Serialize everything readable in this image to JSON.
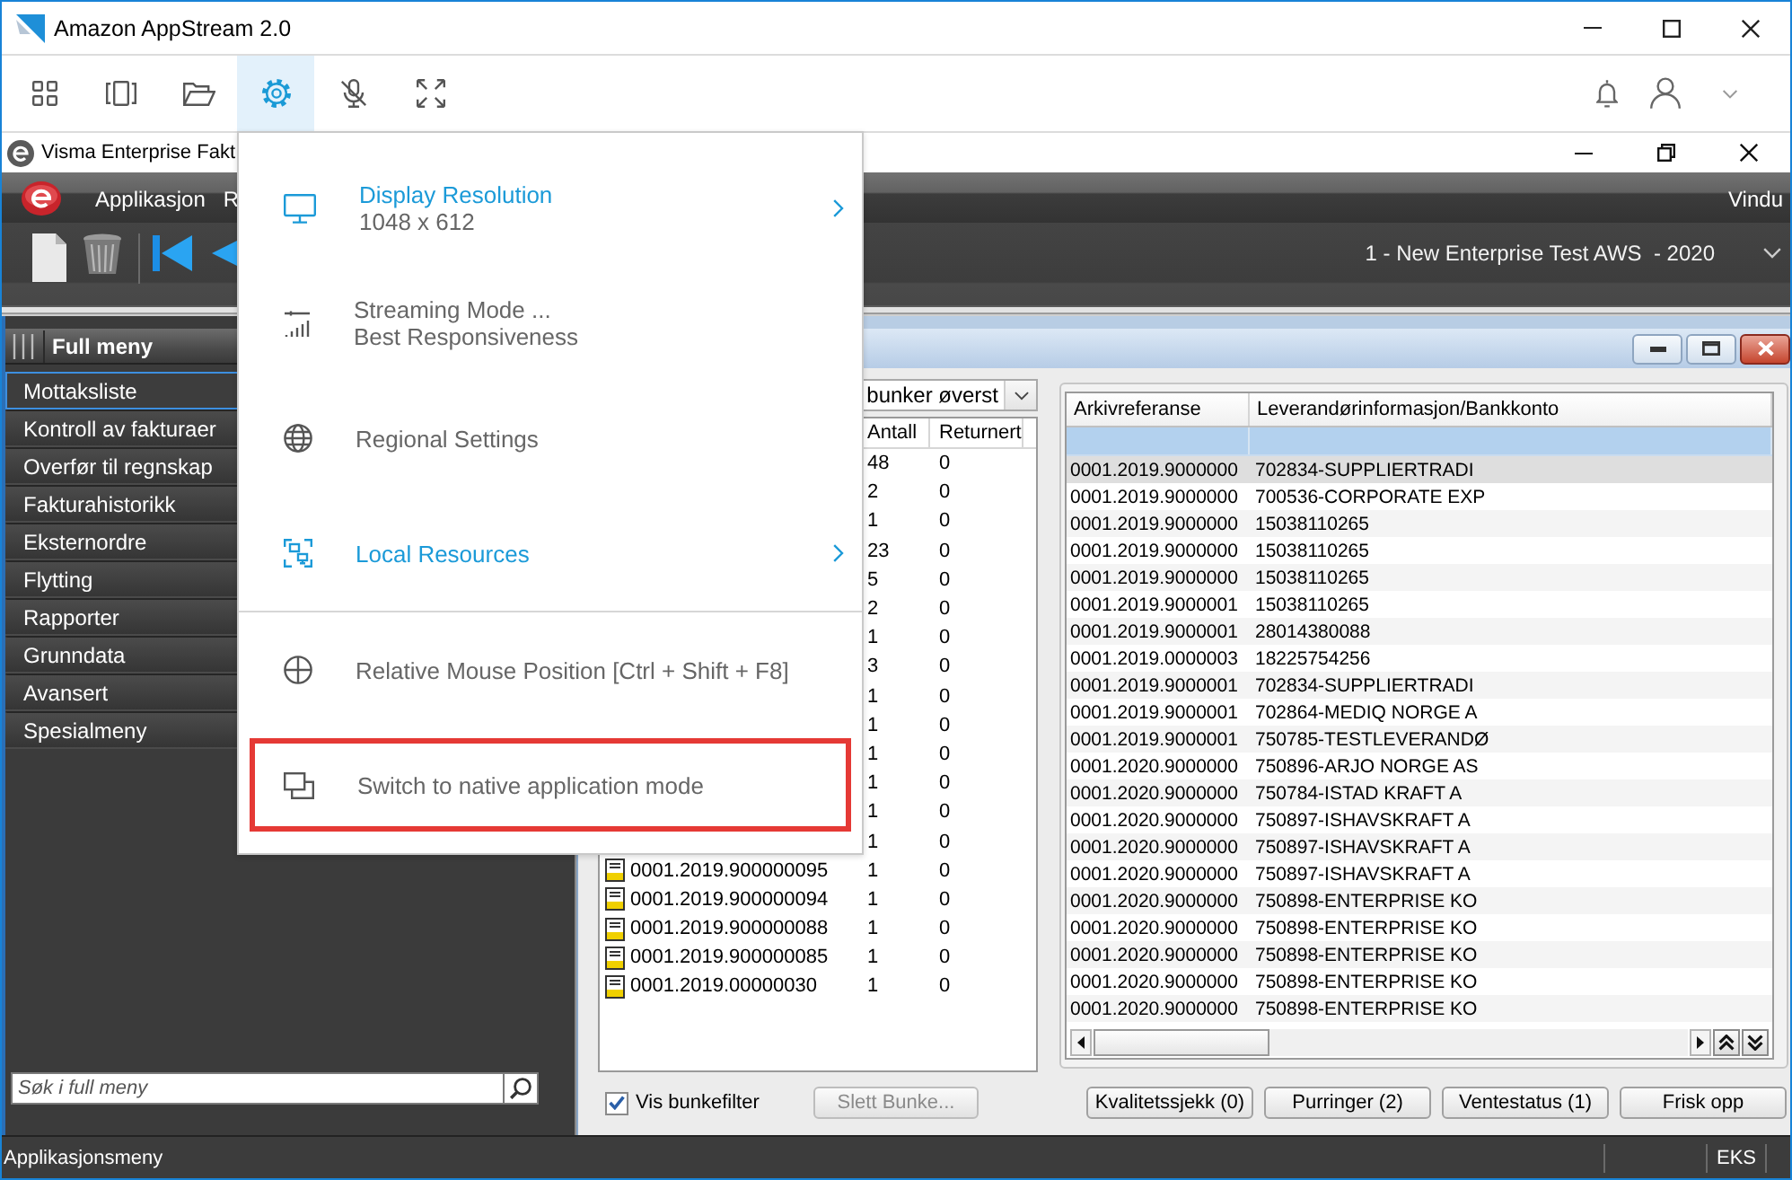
{
  "window": {
    "title": "Amazon AppStream 2.0"
  },
  "toolbar": {
    "buttons": [
      {
        "selected": false
      },
      {
        "selected": false
      },
      {
        "selected": false
      },
      {
        "selected": true
      },
      {
        "selected": false
      },
      {
        "selected": false
      }
    ]
  },
  "settings_menu": {
    "groups": [
      [
        {
          "kind": "submenu",
          "label": "Display Resolution",
          "detail": "1048 x 612",
          "outlined": false
        },
        {
          "kind": "action",
          "label": "Streaming Mode ...",
          "detail": "Best Responsiveness",
          "outlined": false
        },
        {
          "kind": "action",
          "label": "Regional Settings",
          "outlined": false
        },
        {
          "kind": "submenu",
          "label": "Local Resources",
          "outlined": false
        }
      ],
      [
        {
          "kind": "action",
          "label": "Relative Mouse Position [Ctrl + Shift + F8]",
          "outlined": false
        },
        {
          "kind": "action",
          "label": "Switch to native application mode",
          "outlined": true
        }
      ]
    ]
  },
  "app_window": {
    "title": "Visma Enterprise Fakt",
    "menu": [
      "Applikasjon",
      "R"
    ],
    "window_menu": "Vindu",
    "company": "1 - New Enterprise Test AWS  - 2020"
  },
  "sidebar": {
    "title": "Full meny",
    "items": [
      {
        "label": "Mottaksliste",
        "selected": true
      },
      {
        "label": "Kontroll av fakturaer",
        "selected": false
      },
      {
        "label": "Overfør til regnskap",
        "selected": false
      },
      {
        "label": "Fakturahistorikk",
        "selected": false
      },
      {
        "label": "Eksternordre",
        "selected": false
      },
      {
        "label": "Flytting",
        "selected": false
      },
      {
        "label": "Rapporter",
        "selected": false
      },
      {
        "label": "Grunndata",
        "selected": false
      },
      {
        "label": "Avansert",
        "selected": false
      },
      {
        "label": "Spesialmeny",
        "selected": false
      }
    ],
    "search": {
      "placeholder": "Søk i full meny"
    }
  },
  "batch_panel": {
    "sort": "bunker øverst",
    "columns": [
      "Antall",
      "Returnert"
    ],
    "rows": [
      {
        "count": "48",
        "returned": "0"
      },
      {
        "count": "2",
        "returned": "0"
      },
      {
        "count": "1",
        "returned": "0"
      },
      {
        "count": "23",
        "returned": "0"
      },
      {
        "count": "5",
        "returned": "0"
      },
      {
        "count": "2",
        "returned": "0"
      },
      {
        "count": "1",
        "returned": "0"
      },
      {
        "count": "3",
        "returned": "0"
      },
      {
        "count": "1",
        "returned": "0"
      },
      {
        "count": "1",
        "returned": "0"
      },
      {
        "count": "1",
        "returned": "0"
      },
      {
        "count": "1",
        "returned": "0"
      },
      {
        "count": "1",
        "returned": "0"
      },
      {
        "count": "1",
        "returned": "0"
      },
      {
        "name": "0001.2019.900000095",
        "count": "1",
        "returned": "0"
      },
      {
        "name": "0001.2019.900000094",
        "count": "1",
        "returned": "0"
      },
      {
        "name": "0001.2019.900000088",
        "count": "1",
        "returned": "0"
      },
      {
        "name": "0001.2019.900000085",
        "count": "1",
        "returned": "0"
      },
      {
        "name": "0001.2019.00000030",
        "count": "1",
        "returned": "0"
      }
    ],
    "filter": {
      "label": "Vis bunkefilter",
      "checked": true
    },
    "delete_button": {
      "label": "Slett Bunke...",
      "disabled": true
    }
  },
  "invoice_table": {
    "columns": [
      "Arkivreferanse",
      "Leverandørinformasjon/Bankkonto"
    ],
    "rows": [
      {
        "reference": "0001.2019.9000000",
        "supplier": "702834-SUPPLIERTRADI",
        "selected": true
      },
      {
        "reference": "0001.2019.9000000",
        "supplier": "700536-CORPORATE EXP",
        "selected": false
      },
      {
        "reference": "0001.2019.9000000",
        "supplier": "15038110265",
        "selected": false
      },
      {
        "reference": "0001.2019.9000000",
        "supplier": "15038110265",
        "selected": false
      },
      {
        "reference": "0001.2019.9000000",
        "supplier": "15038110265",
        "selected": false
      },
      {
        "reference": "0001.2019.9000001",
        "supplier": "15038110265",
        "selected": false
      },
      {
        "reference": "0001.2019.9000001",
        "supplier": "28014380088",
        "selected": false
      },
      {
        "reference": "0001.2019.0000003",
        "supplier": "18225754256",
        "selected": false
      },
      {
        "reference": "0001.2019.9000001",
        "supplier": "702834-SUPPLIERTRADI",
        "selected": false
      },
      {
        "reference": "0001.2019.9000001",
        "supplier": "702864-MEDIQ NORGE A",
        "selected": false
      },
      {
        "reference": "0001.2019.9000001",
        "supplier": "750785-TESTLEVERANDØ",
        "selected": false
      },
      {
        "reference": "0001.2020.9000000",
        "supplier": "750896-ARJO NORGE AS",
        "selected": false
      },
      {
        "reference": "0001.2020.9000000",
        "supplier": "750784-ISTAD KRAFT A",
        "selected": false
      },
      {
        "reference": "0001.2020.9000000",
        "supplier": "750897-ISHAVSKRAFT A",
        "selected": false
      },
      {
        "reference": "0001.2020.9000000",
        "supplier": "750897-ISHAVSKRAFT A",
        "selected": false
      },
      {
        "reference": "0001.2020.9000000",
        "supplier": "750897-ISHAVSKRAFT A",
        "selected": false
      },
      {
        "reference": "0001.2020.9000000",
        "supplier": "750898-ENTERPRISE KO",
        "selected": false
      },
      {
        "reference": "0001.2020.9000000",
        "supplier": "750898-ENTERPRISE KO",
        "selected": false
      },
      {
        "reference": "0001.2020.9000000",
        "supplier": "750898-ENTERPRISE KO",
        "selected": false
      },
      {
        "reference": "0001.2020.9000000",
        "supplier": "750898-ENTERPRISE KO",
        "selected": false
      },
      {
        "reference": "0001.2020.9000000",
        "supplier": "750898-ENTERPRISE KO",
        "selected": false
      }
    ]
  },
  "action_buttons": [
    "Kvalitetssjekk (0)",
    "Purringer (2)",
    "Ventestatus (1)",
    "Frisk opp"
  ],
  "status_bar": {
    "left": "Applikasjonsmeny",
    "right": "EKS"
  }
}
